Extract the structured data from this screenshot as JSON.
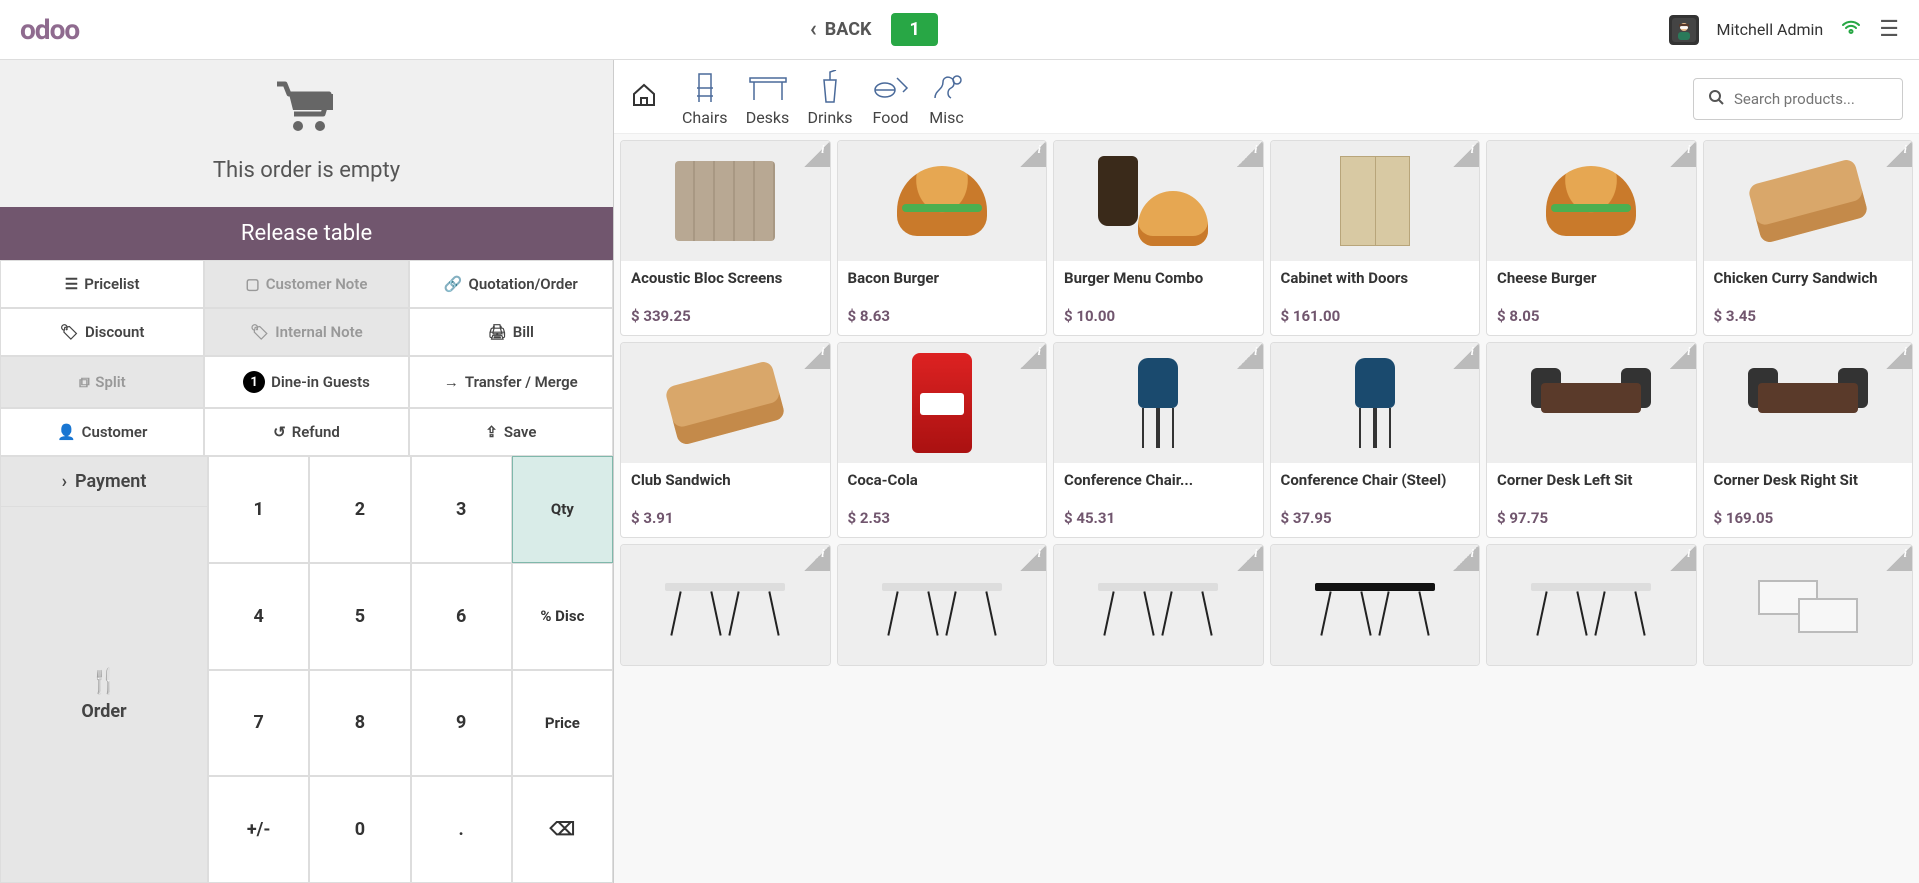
{
  "header": {
    "back": "BACK",
    "table_badge": "1",
    "username": "Mitchell Admin"
  },
  "left": {
    "empty_order": "This order is empty",
    "release": "Release table",
    "actions": {
      "pricelist": "Pricelist",
      "customer_note": "Customer Note",
      "quotation": "Quotation/Order",
      "discount": "Discount",
      "internal_note": "Internal Note",
      "bill": "Bill",
      "split": "Split",
      "guests_count": "1",
      "guests_label": "Dine-in Guests",
      "transfer": "Transfer / Merge",
      "customer": "Customer",
      "refund": "Refund",
      "save": "Save"
    },
    "payment_label": "Payment",
    "order_label": "Order",
    "keypad": {
      "k1": "1",
      "k2": "2",
      "k3": "3",
      "kqty": "Qty",
      "k4": "4",
      "k5": "5",
      "k6": "6",
      "kdisc": "% Disc",
      "k7": "7",
      "k8": "8",
      "k9": "9",
      "kprice": "Price",
      "ksign": "+/-",
      "k0": "0",
      "kdot": ".",
      "kdel": "⌫"
    }
  },
  "categories": [
    {
      "name": "Chairs"
    },
    {
      "name": "Desks"
    },
    {
      "name": "Drinks"
    },
    {
      "name": "Food"
    },
    {
      "name": "Misc"
    }
  ],
  "search": {
    "placeholder": "Search products..."
  },
  "products": [
    {
      "name": "Acoustic Bloc Screens",
      "price": "$ 339.25",
      "vis": "screen"
    },
    {
      "name": "Bacon Burger",
      "price": "$ 8.63",
      "vis": "burger"
    },
    {
      "name": "Burger Menu Combo",
      "price": "$ 10.00",
      "vis": "combo"
    },
    {
      "name": "Cabinet with Doors",
      "price": "$ 161.00",
      "vis": "cabinet"
    },
    {
      "name": "Cheese Burger",
      "price": "$ 8.05",
      "vis": "burger"
    },
    {
      "name": "Chicken Curry Sandwich",
      "price": "$ 3.45",
      "vis": "sandwich"
    },
    {
      "name": "Club Sandwich",
      "price": "$ 3.91",
      "vis": "sandwich"
    },
    {
      "name": "Coca-Cola",
      "price": "$ 2.53",
      "vis": "cola"
    },
    {
      "name": "Conference Chair...",
      "price": "$ 45.31",
      "vis": "chairblue"
    },
    {
      "name": "Conference Chair (Steel)",
      "price": "$ 37.95",
      "vis": "chairblue"
    },
    {
      "name": "Corner Desk Left Sit",
      "price": "$ 97.75",
      "vis": "cornerdesk"
    },
    {
      "name": "Corner Desk Right Sit",
      "price": "$ 169.05",
      "vis": "cornerdesk"
    },
    {
      "name": "",
      "price": "",
      "vis": "deskline"
    },
    {
      "name": "",
      "price": "",
      "vis": "deskline"
    },
    {
      "name": "",
      "price": "",
      "vis": "deskline"
    },
    {
      "name": "",
      "price": "",
      "vis": "deskline-dark"
    },
    {
      "name": "",
      "price": "",
      "vis": "deskline"
    },
    {
      "name": "",
      "price": "",
      "vis": "deskcube"
    }
  ]
}
